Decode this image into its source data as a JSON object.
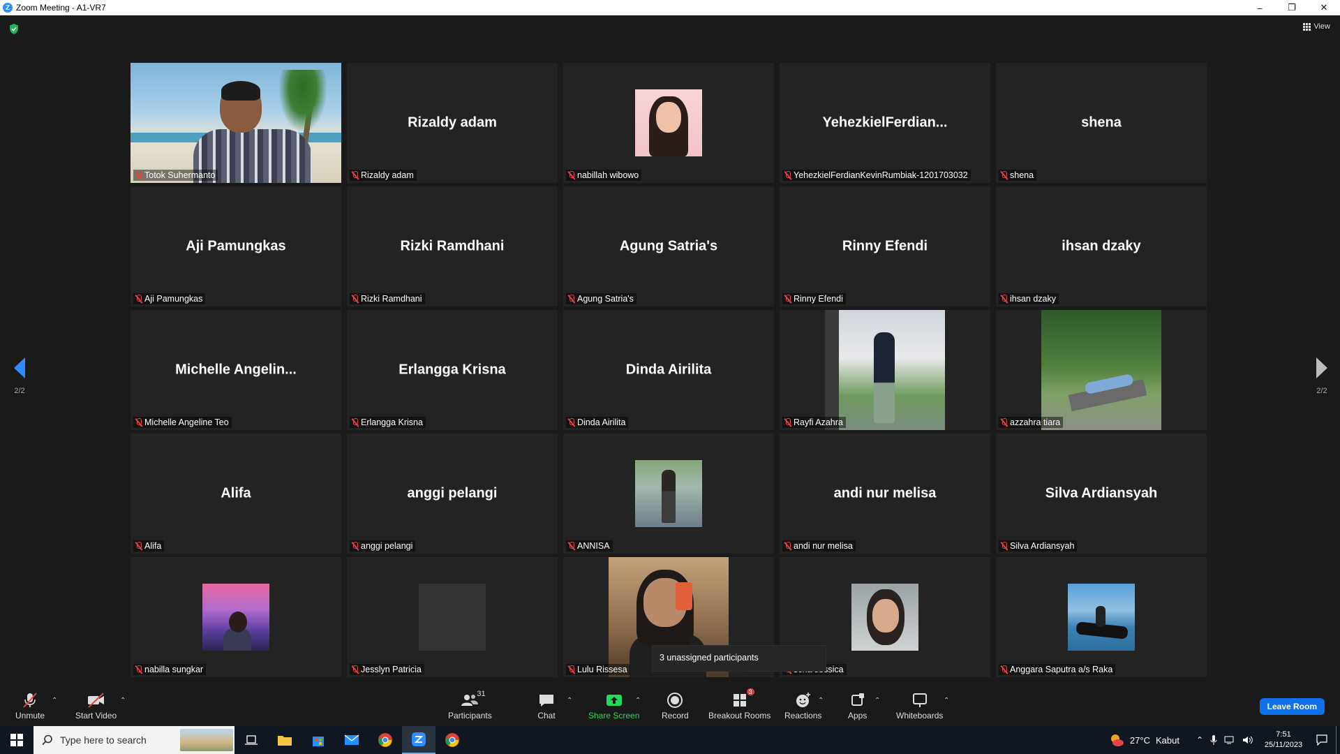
{
  "window": {
    "app_logo": "Z",
    "title": "Zoom Meeting - A1-VR7",
    "controls": [
      "minimize-icon",
      "restore-icon",
      "close-icon"
    ]
  },
  "meeting": {
    "view_label": "View",
    "page_left": "2/2",
    "page_right": "2/2",
    "tooltip": "3 unassigned participants"
  },
  "tiles": [
    {
      "big": "",
      "label": "Totok Suhermanto",
      "photo": "totok"
    },
    {
      "big": "Rizaldy adam",
      "label": "Rizaldy adam",
      "photo": ""
    },
    {
      "big": "",
      "label": "nabillah wibowo",
      "photo": "nab"
    },
    {
      "big": "YehezkielFerdian...",
      "label": "YehezkielFerdianKevinRumbiak-1201703032",
      "photo": ""
    },
    {
      "big": "shena",
      "label": "shena",
      "photo": ""
    },
    {
      "big": "Aji Pamungkas",
      "label": "Aji Pamungkas",
      "photo": ""
    },
    {
      "big": "Rizki Ramdhani",
      "label": "Rizki Ramdhani",
      "photo": ""
    },
    {
      "big": "Agung Satria's",
      "label": "Agung Satria's",
      "photo": ""
    },
    {
      "big": "Rinny Efendi",
      "label": "Rinny Efendi",
      "photo": ""
    },
    {
      "big": "ihsan dzaky",
      "label": "ihsan dzaky",
      "photo": ""
    },
    {
      "big": "Michelle  Angelin...",
      "label": "Michelle Angeline Teo",
      "photo": ""
    },
    {
      "big": "Erlangga Krisna",
      "label": "Erlangga Krisna",
      "photo": ""
    },
    {
      "big": "Dinda Airilita",
      "label": "Dinda Airilita",
      "photo": ""
    },
    {
      "big": "",
      "label": "Rayfi Azahra",
      "photo": "rayfi"
    },
    {
      "big": "",
      "label": "azzahra tiara",
      "photo": "azz"
    },
    {
      "big": "Alifa",
      "label": "Alifa",
      "photo": ""
    },
    {
      "big": "anggi pelangi",
      "label": "anggi pelangi",
      "photo": ""
    },
    {
      "big": "",
      "label": "ANNISA",
      "photo": "annisa"
    },
    {
      "big": "andi nur melisa",
      "label": "andi nur melisa",
      "photo": ""
    },
    {
      "big": "Silva Ardiansyah",
      "label": "Silva Ardiansyah",
      "photo": ""
    },
    {
      "big": "",
      "label": "nabilla sungkar",
      "photo": "nabs"
    },
    {
      "big": "",
      "label": "Jesslyn Patricia",
      "photo": "jess"
    },
    {
      "big": "",
      "label": "Lulu Rissesa",
      "photo": "lulu"
    },
    {
      "big": "",
      "label": "scha Jessica",
      "photo": "tascha"
    },
    {
      "big": "",
      "label": "Anggara Saputra a/s Raka",
      "photo": "angg"
    }
  ],
  "toolbar": {
    "unmute": "Unmute",
    "start_video": "Start Video",
    "participants": "Participants",
    "participants_count": "31",
    "chat": "Chat",
    "share_screen": "Share Screen",
    "record": "Record",
    "breakout_rooms": "Breakout Rooms",
    "breakout_badge": "3",
    "reactions": "Reactions",
    "apps": "Apps",
    "whiteboards": "Whiteboards",
    "leave": "Leave Room",
    "colors": {
      "share_green": "#23d959",
      "leave_blue": "#0e71eb",
      "mute_red": "#e04646",
      "active_border": "#e6e94f"
    }
  },
  "taskbar": {
    "search_placeholder": "Type here to search",
    "weather_temp": "27°C",
    "weather_text": "Kabut",
    "time": "7:51",
    "date": "25/11/2023"
  }
}
